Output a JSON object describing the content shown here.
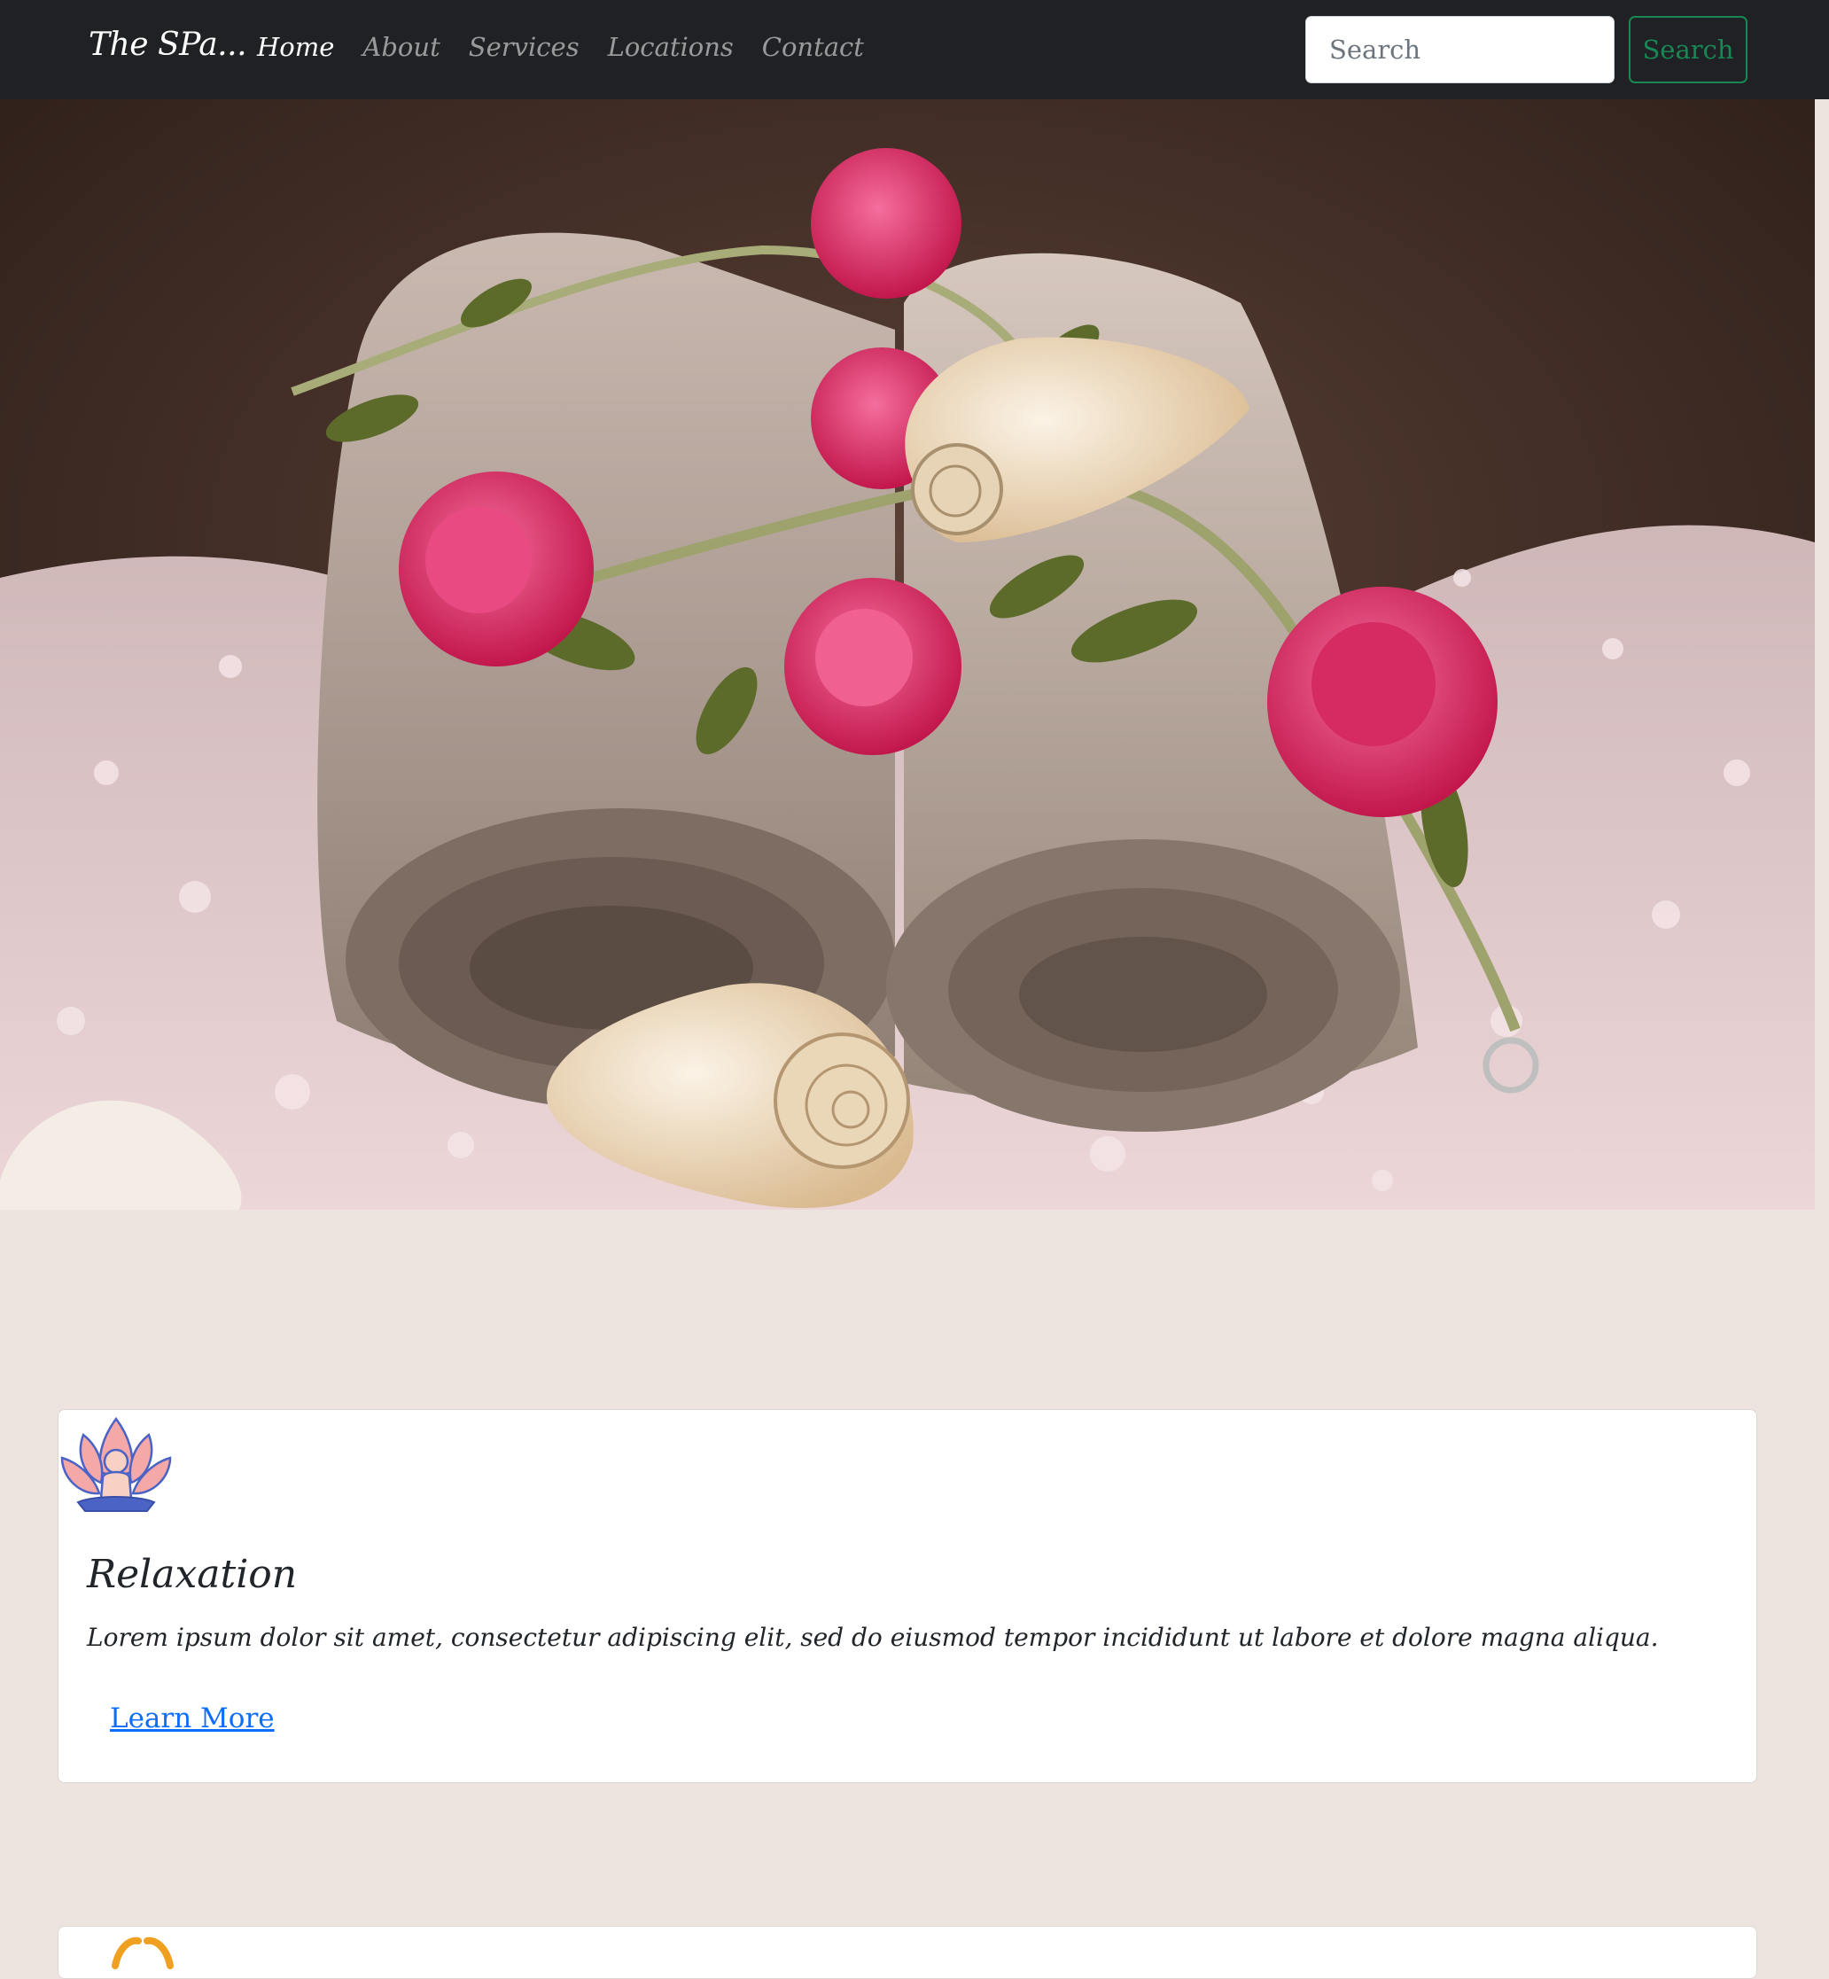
{
  "navbar": {
    "brand": "The SPa...",
    "links": [
      "Home",
      "About",
      "Services",
      "Locations",
      "Contact"
    ],
    "active_link": "Home",
    "search_placeholder": "Search",
    "search_button": "Search",
    "colors": {
      "background": "#1f2125",
      "search_button": "#198754"
    }
  },
  "hero": {
    "image_subject": "rolled spa towels with pink roses, seashells and pink bath salt"
  },
  "page": {
    "background": "#ede3df"
  },
  "cards": [
    {
      "icon": "lotus-meditation-icon",
      "title": "Relaxation",
      "text": "Lorem ipsum dolor sit amet, consectetur adipiscing elit, sed do eiusmod tempor incididunt ut labore et dolore magna aliqua.",
      "link_label": "Learn More",
      "link_color": "#0d6efd"
    },
    {
      "icon": "orange-hands-icon"
    }
  ]
}
